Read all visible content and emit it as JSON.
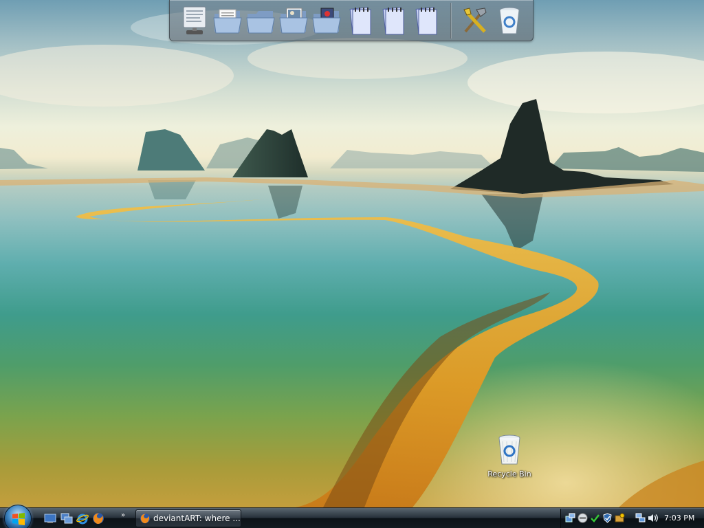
{
  "desktop": {
    "recycle_bin_label": "Recycle Bin"
  },
  "dock": {
    "items": [
      {
        "icon": "monitor-document-icon"
      },
      {
        "icon": "folder-documents-icon"
      },
      {
        "icon": "folder-icon"
      },
      {
        "icon": "folder-pictures-icon"
      },
      {
        "icon": "folder-music-icon"
      },
      {
        "icon": "notepad-icon"
      },
      {
        "icon": "notepad-icon"
      },
      {
        "icon": "notepad-icon"
      },
      {
        "icon": "tools-icon"
      },
      {
        "icon": "recycle-bin-icon"
      }
    ]
  },
  "taskbar": {
    "quick_launch": [
      {
        "icon": "show-desktop-icon"
      },
      {
        "icon": "switch-windows-icon"
      },
      {
        "icon": "internet-explorer-icon"
      },
      {
        "icon": "firefox-icon"
      }
    ],
    "more_label": "»",
    "active_task": {
      "icon": "firefox-icon",
      "label": "deviantART: where ..."
    },
    "tray_icons": [
      "network-tool-icon",
      "messenger-icon",
      "antivirus-icon",
      "security-shield-icon",
      "updates-icon",
      "network-icon",
      "volume-icon"
    ],
    "clock": "7:03 PM"
  },
  "colors": {
    "taskbar_dark": "#0c1217",
    "start_orb": "#3f88c7",
    "sand": "#e8a42c",
    "water": "#3f9c8c"
  }
}
